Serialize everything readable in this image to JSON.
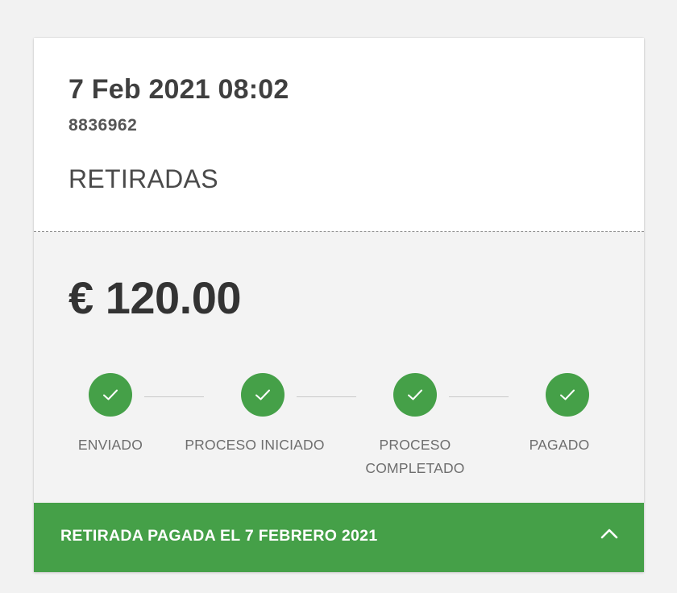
{
  "transaction": {
    "datetime": "7 Feb 2021 08:02",
    "reference": "8836962",
    "type": "RETIRADAS",
    "amount": "€ 120.00"
  },
  "steps": [
    {
      "label": "ENVIADO",
      "status": "completed",
      "icon": "check-icon"
    },
    {
      "label": "PROCESO INICIADO",
      "status": "completed",
      "icon": "check-icon"
    },
    {
      "label": "PROCESO COMPLETADO",
      "status": "completed",
      "icon": "check-icon"
    },
    {
      "label": "PAGADO",
      "status": "completed",
      "icon": "check-icon"
    }
  ],
  "footer": {
    "status_text": "RETIRADA PAGADA EL 7 FEBRERO 2021",
    "toggle_icon": "chevron-up-icon"
  },
  "colors": {
    "success": "#45a048",
    "background": "#f2f2f2",
    "text_dark": "#333333"
  }
}
